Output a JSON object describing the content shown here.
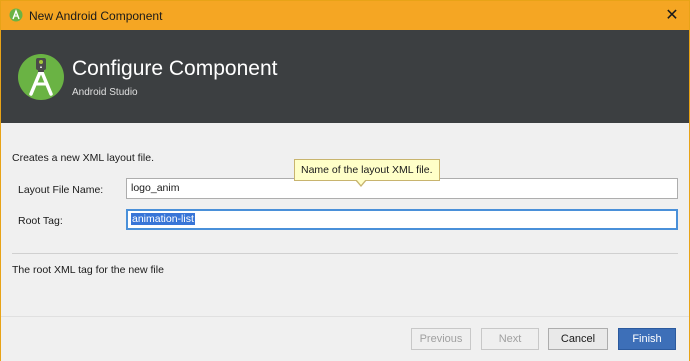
{
  "window": {
    "title": "New Android Component"
  },
  "header": {
    "title": "Configure Component",
    "subtitle": "Android Studio"
  },
  "form": {
    "description": "Creates a new XML layout file.",
    "layout_file_name": {
      "label": "Layout File Name:",
      "value": "logo_anim"
    },
    "root_tag": {
      "label": "Root Tag:",
      "value": "animation-list"
    },
    "tooltip": "Name of the layout XML file.",
    "hint": "The root XML tag for the new file"
  },
  "buttons": {
    "previous": "Previous",
    "next": "Next",
    "cancel": "Cancel",
    "finish": "Finish"
  },
  "colors": {
    "titlebar": "#f5a623",
    "header": "#3c3f41",
    "accent": "#3d6fb8",
    "android_green": "#a4c639"
  },
  "icons": {
    "title_icon": "android-studio-icon",
    "close": "close-icon",
    "logo": "android-studio-logo"
  }
}
